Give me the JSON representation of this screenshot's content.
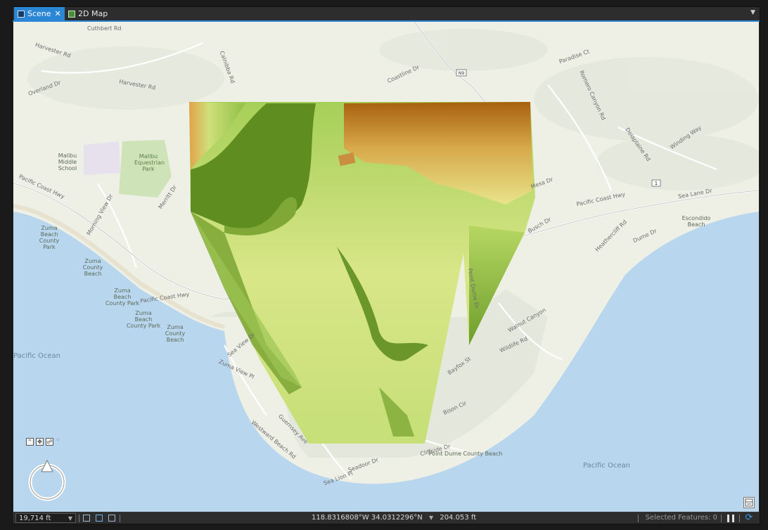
{
  "tabs": [
    {
      "label": "Scene",
      "active": true,
      "icon": "scene-icon"
    },
    {
      "label": "2D Map",
      "active": false,
      "icon": "map-icon"
    }
  ],
  "map": {
    "road_labels": [
      "Cuthbert Rd",
      "Harvester Rd",
      "Harvester Rd",
      "Overland Dr",
      "Calnibba Rd",
      "Coastline Dr",
      "Paradise Ct",
      "Romero Canyon Rd",
      "Delaplaine Rd",
      "Winding Way",
      "Pacific Coast Hwy",
      "Pacific Coast Hwy",
      "Sea Lane Dr",
      "Pacific Coast Hwy",
      "Busch Dr",
      "Morning View Dr",
      "Merritt Dr",
      "Walnut Canyon",
      "Wildlife Rd",
      "Bison Cir",
      "Cliffside Dr",
      "Seadoor Dr",
      "Westward Beach Rd",
      "Sea Lion Pl",
      "Zuma View Pl",
      "Mesa Dr",
      "Guernsey Ave",
      "Sea View Dr",
      "Point Dume Dr",
      "Bayfox St",
      "Heathercliff Rd",
      "Dume Dr"
    ],
    "place_labels": [
      "Malibu Middle School",
      "Malibu Equestrian Park",
      "Zuma Beach County Park",
      "Zuma County Beach",
      "Zuma Beach County Park",
      "Zuma Beach County Park",
      "Zuma County Beach",
      "Escondido Beach",
      "Point Dume County Beach"
    ],
    "ocean_labels": [
      "Pacific Ocean",
      "Pacific Ocean"
    ],
    "route_shield": "1",
    "route_shield_2": "N9"
  },
  "nav_tools": [
    "up-chevron-icon",
    "pan-icon",
    "walk-icon"
  ],
  "statusbar": {
    "scale": "19,714 ft",
    "coordinates": "118.8316808°W 34.0312296°N",
    "elevation": "204.053 ft",
    "selected_features": "Selected Features: 0"
  },
  "colors": {
    "accent": "#2b86d6",
    "ocean": "#b8d6ee",
    "land": "#eef0e6",
    "elev_low": "#4e7d18",
    "elev_mid": "#e8e58a",
    "elev_high": "#9c5a0e"
  }
}
